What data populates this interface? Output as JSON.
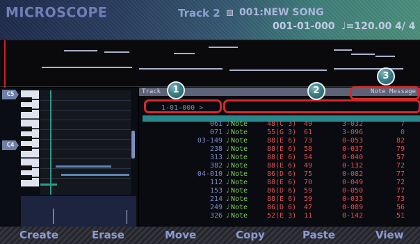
{
  "header": {
    "app_title": "MICROSCOPE",
    "track": "Track 2",
    "song": "001:NEW SONG",
    "position": "001-01-000",
    "tempo_symbol": "♩",
    "tempo": "=120.00",
    "beat": "4/ 4"
  },
  "list": {
    "header_left": "Track",
    "header_right": "Note Message",
    "position_field": "1-01-000",
    "position_arrow": ">",
    "events": [
      {
        "pos": "061",
        "type": "Note",
        "note": "48(C 3)",
        "vel": "49",
        "dur": "3-032",
        "off": "7"
      },
      {
        "pos": "071",
        "type": "Note",
        "note": "55(G 3)",
        "vel": "61",
        "dur": "3-096",
        "off": "0"
      },
      {
        "pos": "03-149",
        "type": "Note",
        "note": "88(E 6)",
        "vel": "73",
        "dur": "0-053",
        "off": "82"
      },
      {
        "pos": "238",
        "type": "Note",
        "note": "88(E 6)",
        "vel": "58",
        "dur": "0-037",
        "off": "79"
      },
      {
        "pos": "313",
        "type": "Note",
        "note": "88(E 6)",
        "vel": "54",
        "dur": "0-040",
        "off": "57"
      },
      {
        "pos": "382",
        "type": "Note",
        "note": "88(E 6)",
        "vel": "49",
        "dur": "0-132",
        "off": "72"
      },
      {
        "pos": "04-010",
        "type": "Note",
        "note": "86(D 6)",
        "vel": "75",
        "dur": "0-082",
        "off": "77"
      },
      {
        "pos": "112",
        "type": "Note",
        "note": "88(E 6)",
        "vel": "70",
        "dur": "0-049",
        "off": "72"
      },
      {
        "pos": "153",
        "type": "Note",
        "note": "86(D 6)",
        "vel": "59",
        "dur": "0-050",
        "off": "77"
      },
      {
        "pos": "214",
        "type": "Note",
        "note": "88(E 6)",
        "vel": "59",
        "dur": "0-033",
        "off": "73"
      },
      {
        "pos": "249",
        "type": "Note",
        "note": "86(D 6)",
        "vel": "47",
        "dur": "0-089",
        "off": "56"
      },
      {
        "pos": "326",
        "type": "Note",
        "note": "52(E 3)",
        "vel": "11",
        "dur": "0-142",
        "off": "51"
      }
    ]
  },
  "octave_tabs": [
    "C5",
    "C4"
  ],
  "callouts": [
    "1",
    "2",
    "3"
  ],
  "footer": {
    "buttons": [
      "Create",
      "Erase",
      "Move",
      "Copy",
      "Paste",
      "View"
    ]
  },
  "colors": {
    "callout_red": "#d8282c",
    "note_green": "#7bd05a",
    "value_red": "#e05050",
    "selection_teal": "#2e9ea0"
  }
}
